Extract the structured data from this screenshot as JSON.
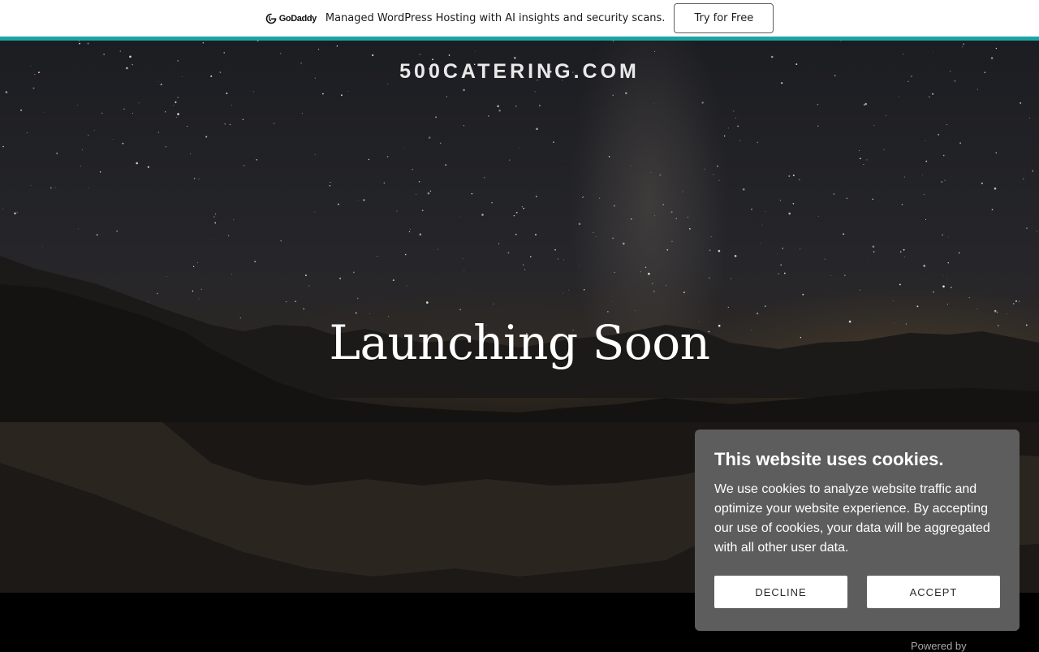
{
  "promo": {
    "brand": "GoDaddy",
    "logo_icon": "godaddy-logo-icon",
    "message": "Managed WordPress Hosting with AI insights and security scans.",
    "cta_label": "Try for Free",
    "accent_color": "#1ba4a4"
  },
  "hero": {
    "site_name": "500CATERING.COM",
    "headline": "Launching Soon"
  },
  "cookie": {
    "title": "This website uses cookies.",
    "body": "We use cookies to analyze website traffic and optimize your website experience. By accepting our use of cookies, your data will be aggregated with all other user data.",
    "decline_label": "DECLINE",
    "accept_label": "ACCEPT",
    "background_color": "#5d5d5d"
  },
  "footer": {
    "powered_by": "Powered by"
  }
}
